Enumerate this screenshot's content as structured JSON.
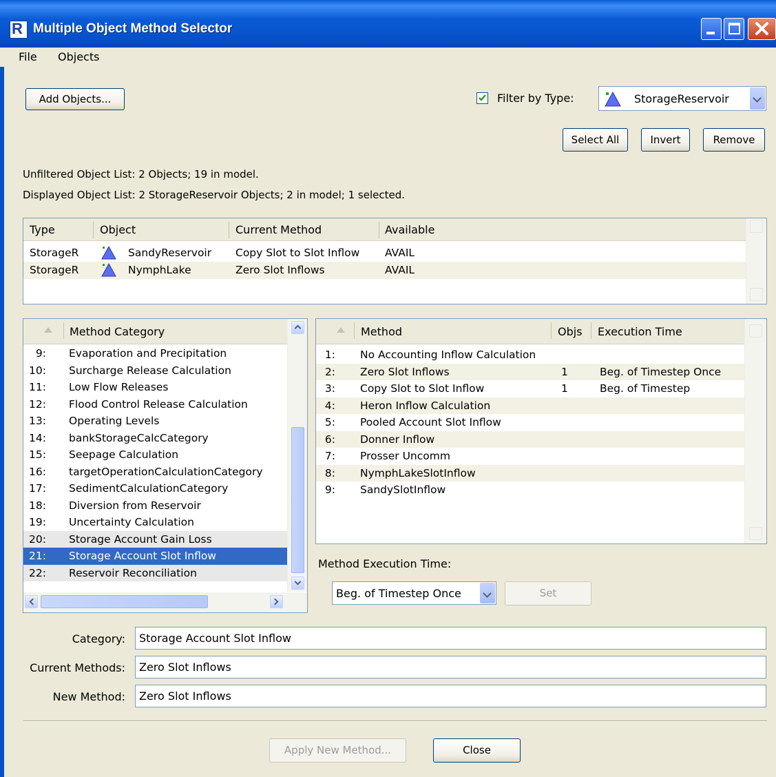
{
  "window": {
    "title": "Multiple Object Method Selector"
  },
  "menu": {
    "file": "File",
    "objects": "Objects"
  },
  "toolbar": {
    "add_objects": "Add Objects...",
    "filter_checked": true,
    "filter_label": "Filter by Type:",
    "filter_value": "StorageReservoir",
    "select_all": "Select All",
    "invert": "Invert",
    "remove": "Remove"
  },
  "summary": {
    "unfiltered": "Unfiltered Object List:  2 Objects;  19 in model.",
    "displayed": "Displayed Object List:  2 StorageReservoir Objects;  2 in model;  1 selected."
  },
  "object_table": {
    "headers": [
      "Type",
      "Object",
      "Current Method",
      "Available"
    ],
    "rows": [
      {
        "type": "StorageR",
        "object": "SandyReservoir",
        "method": "Copy Slot to Slot Inflow",
        "available": "AVAIL"
      },
      {
        "type": "StorageR",
        "object": "NymphLake",
        "method": "Zero Slot Inflows",
        "available": "AVAIL"
      }
    ]
  },
  "category_list": {
    "header": "Method Category",
    "items": [
      {
        "num": "9:",
        "name": "Evaporation and Precipitation"
      },
      {
        "num": "10:",
        "name": "Surcharge Release Calculation"
      },
      {
        "num": "11:",
        "name": "Low Flow Releases"
      },
      {
        "num": "12:",
        "name": "Flood Control Release Calculation"
      },
      {
        "num": "13:",
        "name": "Operating Levels"
      },
      {
        "num": "14:",
        "name": "bankStorageCalcCategory"
      },
      {
        "num": "15:",
        "name": "Seepage Calculation"
      },
      {
        "num": "16:",
        "name": "targetOperationCalculationCategory"
      },
      {
        "num": "17:",
        "name": "SedimentCalculationCategory"
      },
      {
        "num": "18:",
        "name": "Diversion from Reservoir"
      },
      {
        "num": "19:",
        "name": "Uncertainty Calculation"
      },
      {
        "num": "20:",
        "name": "Storage Account Gain Loss"
      },
      {
        "num": "21:",
        "name": "Storage Account Slot Inflow"
      },
      {
        "num": "22:",
        "name": "Reservoir Reconciliation"
      }
    ],
    "selected_index": 12
  },
  "method_list": {
    "headers": [
      "Method",
      "Objs",
      "Execution Time"
    ],
    "items": [
      {
        "num": "1:",
        "name": "No Accounting Inflow Calculation",
        "objs": "",
        "time": ""
      },
      {
        "num": "2:",
        "name": "Zero Slot Inflows",
        "objs": "1",
        "time": "Beg. of Timestep Once"
      },
      {
        "num": "3:",
        "name": "Copy Slot to Slot Inflow",
        "objs": "1",
        "time": "Beg. of Timestep"
      },
      {
        "num": "4:",
        "name": "Heron Inflow Calculation",
        "objs": "",
        "time": ""
      },
      {
        "num": "5:",
        "name": "Pooled Account Slot Inflow",
        "objs": "",
        "time": ""
      },
      {
        "num": "6:",
        "name": "Donner Inflow",
        "objs": "",
        "time": ""
      },
      {
        "num": "7:",
        "name": "Prosser Uncomm",
        "objs": "",
        "time": ""
      },
      {
        "num": "8:",
        "name": "NymphLakeSlotInflow",
        "objs": "",
        "time": ""
      },
      {
        "num": "9:",
        "name": "SandySlotInflow",
        "objs": "",
        "time": ""
      }
    ]
  },
  "exec_time": {
    "label": "Method Execution Time:",
    "value": "Beg. of Timestep Once",
    "set": "Set"
  },
  "details": {
    "category_label": "Category:",
    "category_value": "Storage Account Slot Inflow",
    "current_label": "Current Methods:",
    "current_value": "Zero Slot Inflows",
    "new_label": "New Method:",
    "new_value": "Zero Slot Inflows"
  },
  "footer": {
    "apply": "Apply New Method...",
    "close": "Close"
  },
  "colors": {
    "selection": "#316ac5",
    "title_bar": "#0650c8",
    "background": "#ece9d8"
  }
}
